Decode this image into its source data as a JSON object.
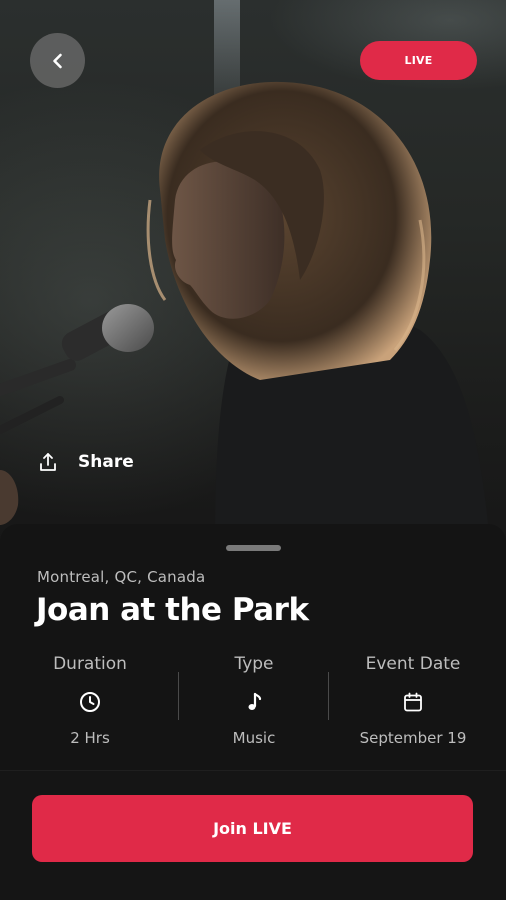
{
  "header": {
    "live_badge": "LIVE"
  },
  "hero": {
    "share_label": "Share"
  },
  "event": {
    "location": "Montreal, QC, Canada",
    "title": "Joan at the Park",
    "stats": [
      {
        "label": "Duration",
        "icon": "clock-icon",
        "value": "2 Hrs"
      },
      {
        "label": "Type",
        "icon": "music-note-icon",
        "value": "Music"
      },
      {
        "label": "Event Date",
        "icon": "calendar-icon",
        "value": "September 19"
      }
    ]
  },
  "footer": {
    "join_label": "Join LIVE"
  },
  "colors": {
    "accent": "#e02a48",
    "sheet_background": "#141414",
    "muted_text": "#bdbdbd"
  }
}
